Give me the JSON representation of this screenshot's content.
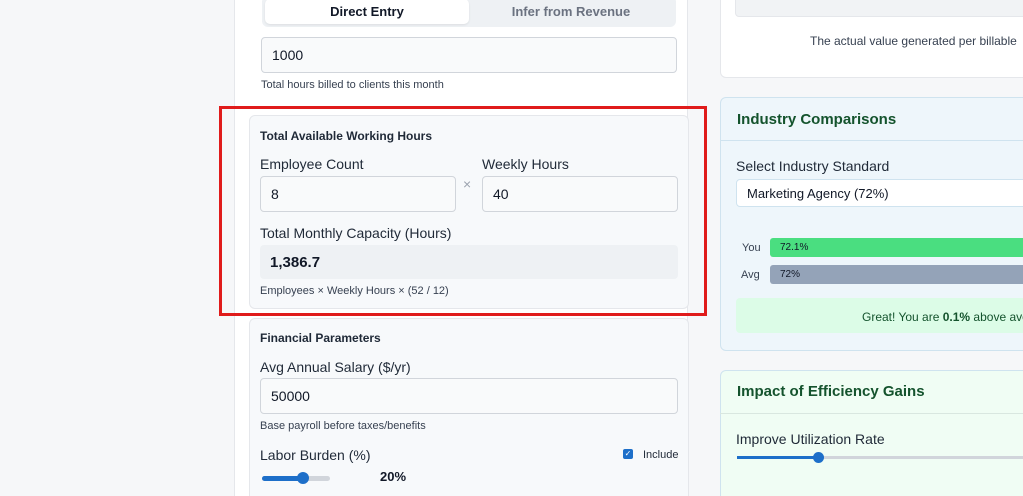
{
  "tabs": {
    "direct_entry": "Direct Entry",
    "infer_revenue": "Infer from Revenue"
  },
  "billable": {
    "value": "1000",
    "help": "Total hours billed to clients this month"
  },
  "capacity": {
    "section_title": "Total Available Working Hours",
    "employee_label": "Employee Count",
    "employee_value": "8",
    "weekly_label": "Weekly Hours",
    "weekly_value": "40",
    "times_symbol": "×",
    "total_label": "Total Monthly Capacity (Hours)",
    "total_value": "1,386.7",
    "formula": "Employees × Weekly Hours × (52 / 12)"
  },
  "financial": {
    "section_title": "Financial Parameters",
    "salary_label": "Avg Annual Salary ($/yr)",
    "salary_value": "50000",
    "salary_help": "Base payroll before taxes/benefits",
    "burden_label": "Labor Burden (%)",
    "burden_value": "20%",
    "burden_fraction": 0.2,
    "include_label": "Include",
    "include_checked": true
  },
  "right": {
    "value_text": "The actual value generated per billable",
    "industry": {
      "title": "Industry Comparisons",
      "select_label": "Select Industry Standard",
      "select_value": "Marketing Agency (72%)",
      "you_label": "You",
      "you_value": "72.1%",
      "avg_label": "Avg",
      "avg_value": "72%",
      "great_prefix": "Great! You are ",
      "great_bold": "0.1%",
      "great_suffix": " above ave"
    },
    "impact": {
      "title": "Impact of Efficiency Gains",
      "improve_label": "Improve Utilization Rate"
    }
  },
  "colors": {
    "accent": "#1d6fc9",
    "highlight": "#e01b1b",
    "you_bar": "#4ade80",
    "avg_bar": "#94a3b8",
    "title_green": "#14532d"
  }
}
